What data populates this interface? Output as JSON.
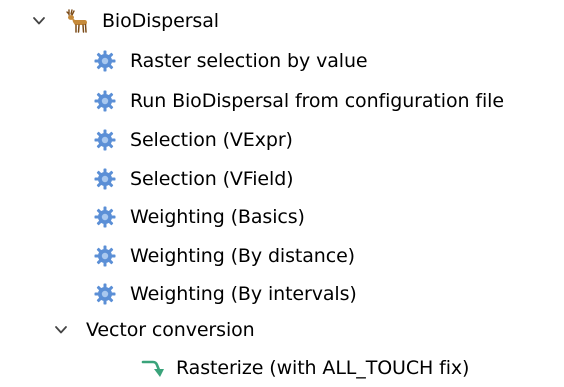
{
  "tree": {
    "group": {
      "label": "BioDispersal",
      "icon": "deer-icon",
      "expanded": true,
      "items": [
        {
          "label": "Raster selection by value",
          "icon": "gear-icon"
        },
        {
          "label": "Run BioDispersal from configuration file",
          "icon": "gear-icon"
        },
        {
          "label": "Selection (VExpr)",
          "icon": "gear-icon"
        },
        {
          "label": "Selection (VField)",
          "icon": "gear-icon"
        },
        {
          "label": "Weighting (Basics)",
          "icon": "gear-icon"
        },
        {
          "label": "Weighting (By distance)",
          "icon": "gear-icon"
        },
        {
          "label": "Weighting (By intervals)",
          "icon": "gear-icon"
        }
      ]
    },
    "subgroup": {
      "label": "Vector conversion",
      "expanded": true,
      "items": [
        {
          "label": "Rasterize (with ALL_TOUCH fix)",
          "icon": "model-arrow-icon"
        }
      ]
    }
  },
  "colors": {
    "gear": "#5b8fd6",
    "gear_light": "#a9c8ef",
    "deer": "#c68a3a",
    "deer_dark": "#7a4a17",
    "model_arrow": "#3aa37a",
    "chevron": "#444444"
  }
}
